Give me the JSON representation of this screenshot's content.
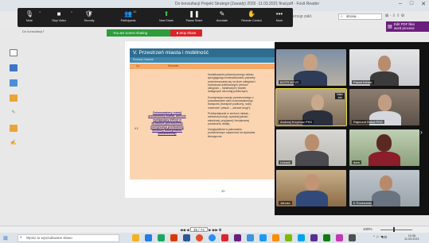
{
  "window": {
    "title": "Do konsultacji Projekt Strategii (Zasady) 2026 ·11.03.2021 final.pdf · Foxit Reader",
    "controls": [
      "–",
      "□",
      "✕"
    ]
  },
  "zoom_toolbar": {
    "items": [
      {
        "icon": "🎙",
        "icon_name": "microphone-icon",
        "label": "Mute"
      },
      {
        "icon": "■",
        "icon_name": "video-camera-icon",
        "label": "Stop Video"
      },
      {
        "icon": "🛡",
        "icon_name": "shield-icon",
        "label": "Security"
      },
      {
        "icon": "👥",
        "icon_name": "participants-icon",
        "label": "Participants",
        "count": "12"
      },
      {
        "icon": "⬆",
        "icon_name": "share-screen-icon",
        "label": "New Share"
      },
      {
        "icon": "❚❚",
        "icon_name": "pause-icon",
        "label": "Pause Share"
      },
      {
        "icon": "✎",
        "icon_name": "annotate-icon",
        "label": "Annotate"
      },
      {
        "icon": "✋",
        "icon_name": "remote-control-icon",
        "label": "Remote Control"
      },
      {
        "icon": "•••",
        "icon_name": "more-icon",
        "label": "More"
      }
    ]
  },
  "share_banner": {
    "text": "You are screen sharing",
    "stop_label": "■ Stop Share"
  },
  "reader_right": {
    "doc_text": "ersup zakł.",
    "search_value": "strona",
    "icons": "⊠ · ⇩ ⇧ ⚙",
    "pdf_button_line1": "Edit PDF files",
    "pdf_button_line2": "word process"
  },
  "left_tools_text": "Do konsultacji Ⅰ",
  "document": {
    "heading": "V. Przestrzeń miasta i mobilność",
    "subheading": "Rozwój Gdańsk",
    "col_lp": "Lp.",
    "col_nazwa": "Kierunek",
    "row_num": "V.1",
    "row_title": "Zrównoważony rozwój przestrzenny miasta, obecnie występujący deficyt w strukturze przestrzennej (kontynuacja przebudowy struktury funkcjonalno-przestrzennej)",
    "desc_paragraphs": [
      "Kształtowanie policentrycznego układu sprzyjającego minimalizowaniu potrzeby przemieszczania się na duże odległości i rozbudowa dzielnicowych centrów usługowo – handlowych i tkanek dostępnych dla usług publicznych;",
      "Koordynacja rozwoju przestrzennego z powstawaniem sieci zrównoważonego transportu (transport publiczny, ruchy rowerowe i piesze – „zdrowe drogi”);",
      "Przekształcanie w centrum miasta – centralnej funkcji, wysokiej jakości zabudowy, przyjaznej i bezpiecznej przestrzeni, dbałej;",
      "Uwzględnienie w planowaniu przestrzennym odporności na wyzwania klimatyczne."
    ],
    "page_number": "35"
  },
  "gallery": {
    "participants": [
      {
        "name": "BOTR MYVC"
      },
      {
        "name": "Paweł Kliński"
      },
      {
        "name": "Andrzej Krzyżosz PKD"
      },
      {
        "name": "Rajmund Bubal PKD"
      },
      {
        "name": "Leszek"
      },
      {
        "name": "dom"
      },
      {
        "name": "Janusz"
      },
      {
        "name": "E.Rozkowski"
      }
    ],
    "talk_badge": "Make Join",
    "next_arrow": "›"
  },
  "pdf_status": {
    "nav_prev": "◀◀ ◀",
    "page_value": "35 / 74",
    "nav_next": "▶ ▶▶ ⧉",
    "zoom": "100%"
  },
  "taskbar": {
    "search_placeholder": "Wpisz tu wyszukiwane słowo",
    "tray": "⌃ ⚐ ◥ ⊟",
    "time": "10:36",
    "date": "11.03.2021"
  }
}
